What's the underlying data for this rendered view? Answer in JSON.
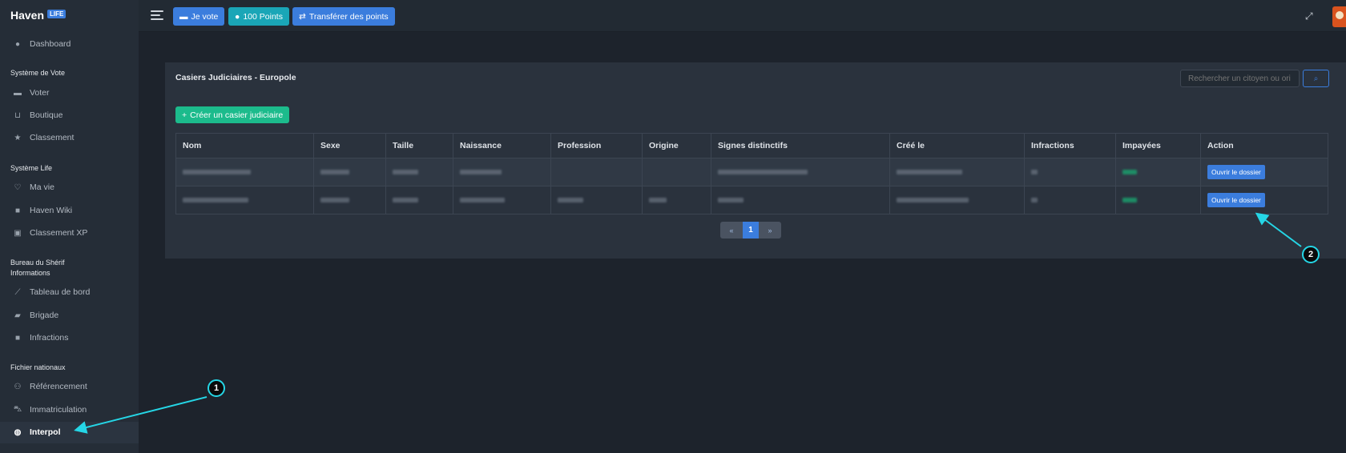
{
  "brand": {
    "name": "Haven",
    "badge": "LIFE"
  },
  "sidebar": {
    "dashboard": "Dashboard",
    "sections": [
      {
        "title": "Système de Vote",
        "items": [
          "Voter",
          "Boutique",
          "Classement"
        ]
      },
      {
        "title": "Système Life",
        "items": [
          "Ma vie",
          "Haven Wiki",
          "Classement XP"
        ]
      },
      {
        "title_line1": "Bureau du Shérif",
        "title_line2": "Informations",
        "items": [
          "Tableau de bord",
          "Brigade",
          "Infractions"
        ]
      },
      {
        "title": "Fichier nationaux",
        "items": [
          "Référencement",
          "Immatriculation",
          "Interpol"
        ]
      }
    ],
    "active": "Interpol"
  },
  "topbar": {
    "vote_label": "Je vote",
    "points_label": "100 Points",
    "transfer_label": "Transférer des points"
  },
  "card": {
    "title": "Casiers Judiciaires - Europole",
    "search_placeholder": "Rechercher un citoyen ou ori",
    "create_label": "Créer un casier judiciaire",
    "columns": [
      "Nom",
      "Sexe",
      "Taille",
      "Naissance",
      "Profession",
      "Origine",
      "Signes distinctifs",
      "Créé le",
      "Infractions",
      "Impayées",
      "Action"
    ],
    "row_action_label": "Ouvrir le dossier",
    "rows_visible": 2,
    "page_current": "1"
  },
  "annotations": {
    "callout_1": "1",
    "callout_2": "2"
  },
  "colors": {
    "accent": "#3b7ddd",
    "success": "#1cbb8c",
    "teal": "#1aa6b7",
    "annotation": "#25d6e6"
  }
}
